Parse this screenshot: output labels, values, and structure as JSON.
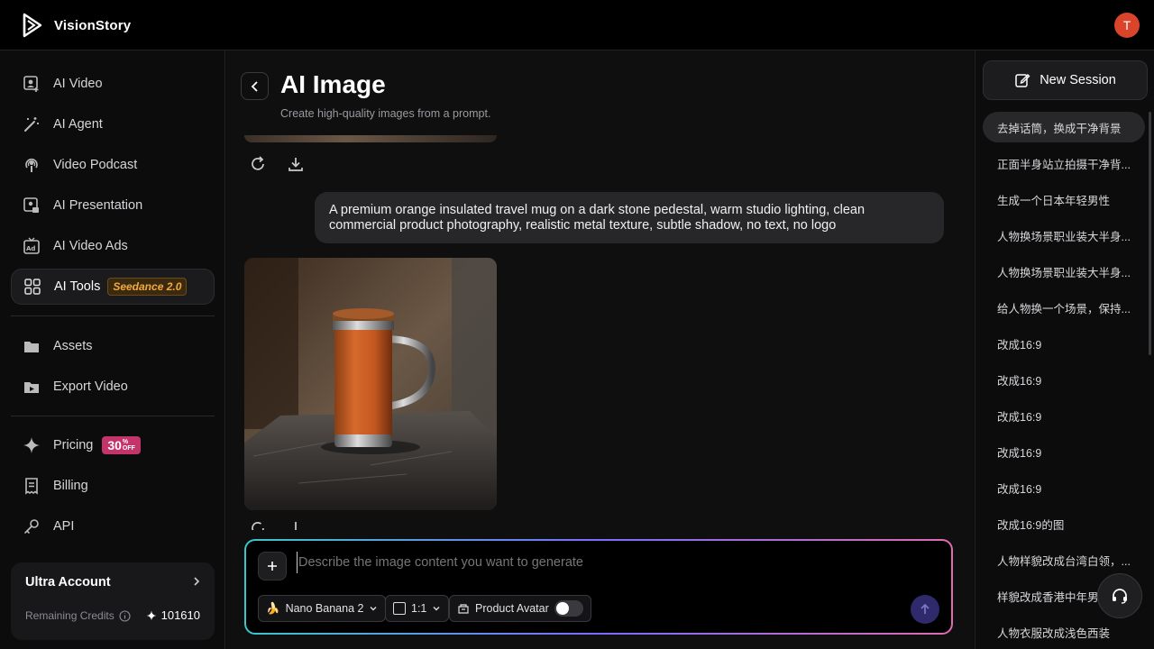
{
  "app": {
    "brand_name": "VisionStory",
    "user_initial": "T"
  },
  "sidebar": {
    "items": [
      {
        "label": "AI Video",
        "icon": "person-video-icon"
      },
      {
        "label": "AI Agent",
        "icon": "magic-wand-icon"
      },
      {
        "label": "Video Podcast",
        "icon": "podcast-icon"
      },
      {
        "label": "AI Presentation",
        "icon": "presentation-icon"
      },
      {
        "label": "AI Video Ads",
        "icon": "ads-icon"
      },
      {
        "label": "AI Tools",
        "icon": "grid-icon",
        "badge": "Seedance 2.0"
      },
      {
        "label": "Assets",
        "icon": "folder-icon"
      },
      {
        "label": "Export Video",
        "icon": "export-video-icon"
      },
      {
        "label": "Pricing",
        "icon": "sparkle-icon",
        "badge_number": "30",
        "badge_pct": "%",
        "badge_off": "OFF"
      },
      {
        "label": "Billing",
        "icon": "receipt-icon"
      },
      {
        "label": "API",
        "icon": "key-icon"
      }
    ],
    "account": {
      "title": "Ultra Account",
      "credits_label": "Remaining Credits",
      "credits_value": "101610"
    }
  },
  "main": {
    "title": "AI Image",
    "subtitle": "Create high-quality images from a prompt.",
    "prompt_text": "A premium orange insulated travel mug on a dark stone pedestal, warm studio lighting, clean commercial product photography, realistic metal texture, subtle shadow, no text, no logo",
    "composer": {
      "placeholder": "Describe the image content you want to generate",
      "model": "Nano Banana 2",
      "ratio": "1:1",
      "product_avatar": "Product Avatar"
    }
  },
  "rightbar": {
    "new_session_label": "New Session",
    "sessions": [
      "去掉话筒，换成干净背景",
      "正面半身站立拍摄干净背...",
      "生成一个日本年轻男性",
      "人物换场景职业装大半身...",
      "人物换场景职业装大半身...",
      "给人物换一个场景，保持...",
      "改成16:9",
      "改成16:9",
      "改成16:9",
      "改成16:9",
      "改成16:9",
      "改成16:9的图",
      "人物样貌改成台湾白领，...",
      "样貌改成香港中年男性",
      "人物衣服改成浅色西装"
    ]
  },
  "colors": {
    "accent_orange": "#f2a93b",
    "pricing_badge": "#c2346a",
    "avatar": "#d9442b"
  }
}
